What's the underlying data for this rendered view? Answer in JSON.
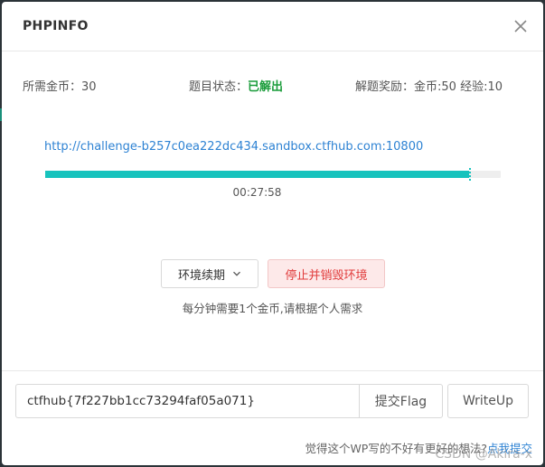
{
  "modal": {
    "title": "PHPINFO"
  },
  "info": {
    "coins_label": "所需金币：",
    "coins_value": "30",
    "status_label": "题目状态：",
    "status_value": "已解出",
    "reward_label": "解题奖励：",
    "reward_value": "金币:50 经验:10"
  },
  "environment": {
    "url": "http://challenge-b257c0ea222dc434.sandbox.ctfhub.com:10800",
    "remaining_fraction": 0.93,
    "timer": "00:27:58",
    "renew_label": "环境续期",
    "destroy_label": "停止并销毁环境",
    "hint": "每分钟需要1个金币,请根据个人需求"
  },
  "submit": {
    "flag_value": "ctfhub{7f227bb1cc73294faf05a071}",
    "submit_label": "提交Flag",
    "writeup_label": "WriteUp"
  },
  "feedback": {
    "text": "觉得这个WP写的不好有更好的想法?",
    "link": "点我提交"
  },
  "watermark": "CSDN @Akira-x",
  "colors": {
    "accent": "#17c3bd",
    "success": "#1a9c3a",
    "danger": "#e13b3b",
    "link": "#2d82d3"
  },
  "icons": {
    "close": "close-icon",
    "dropdown": "chevron-down-icon"
  }
}
